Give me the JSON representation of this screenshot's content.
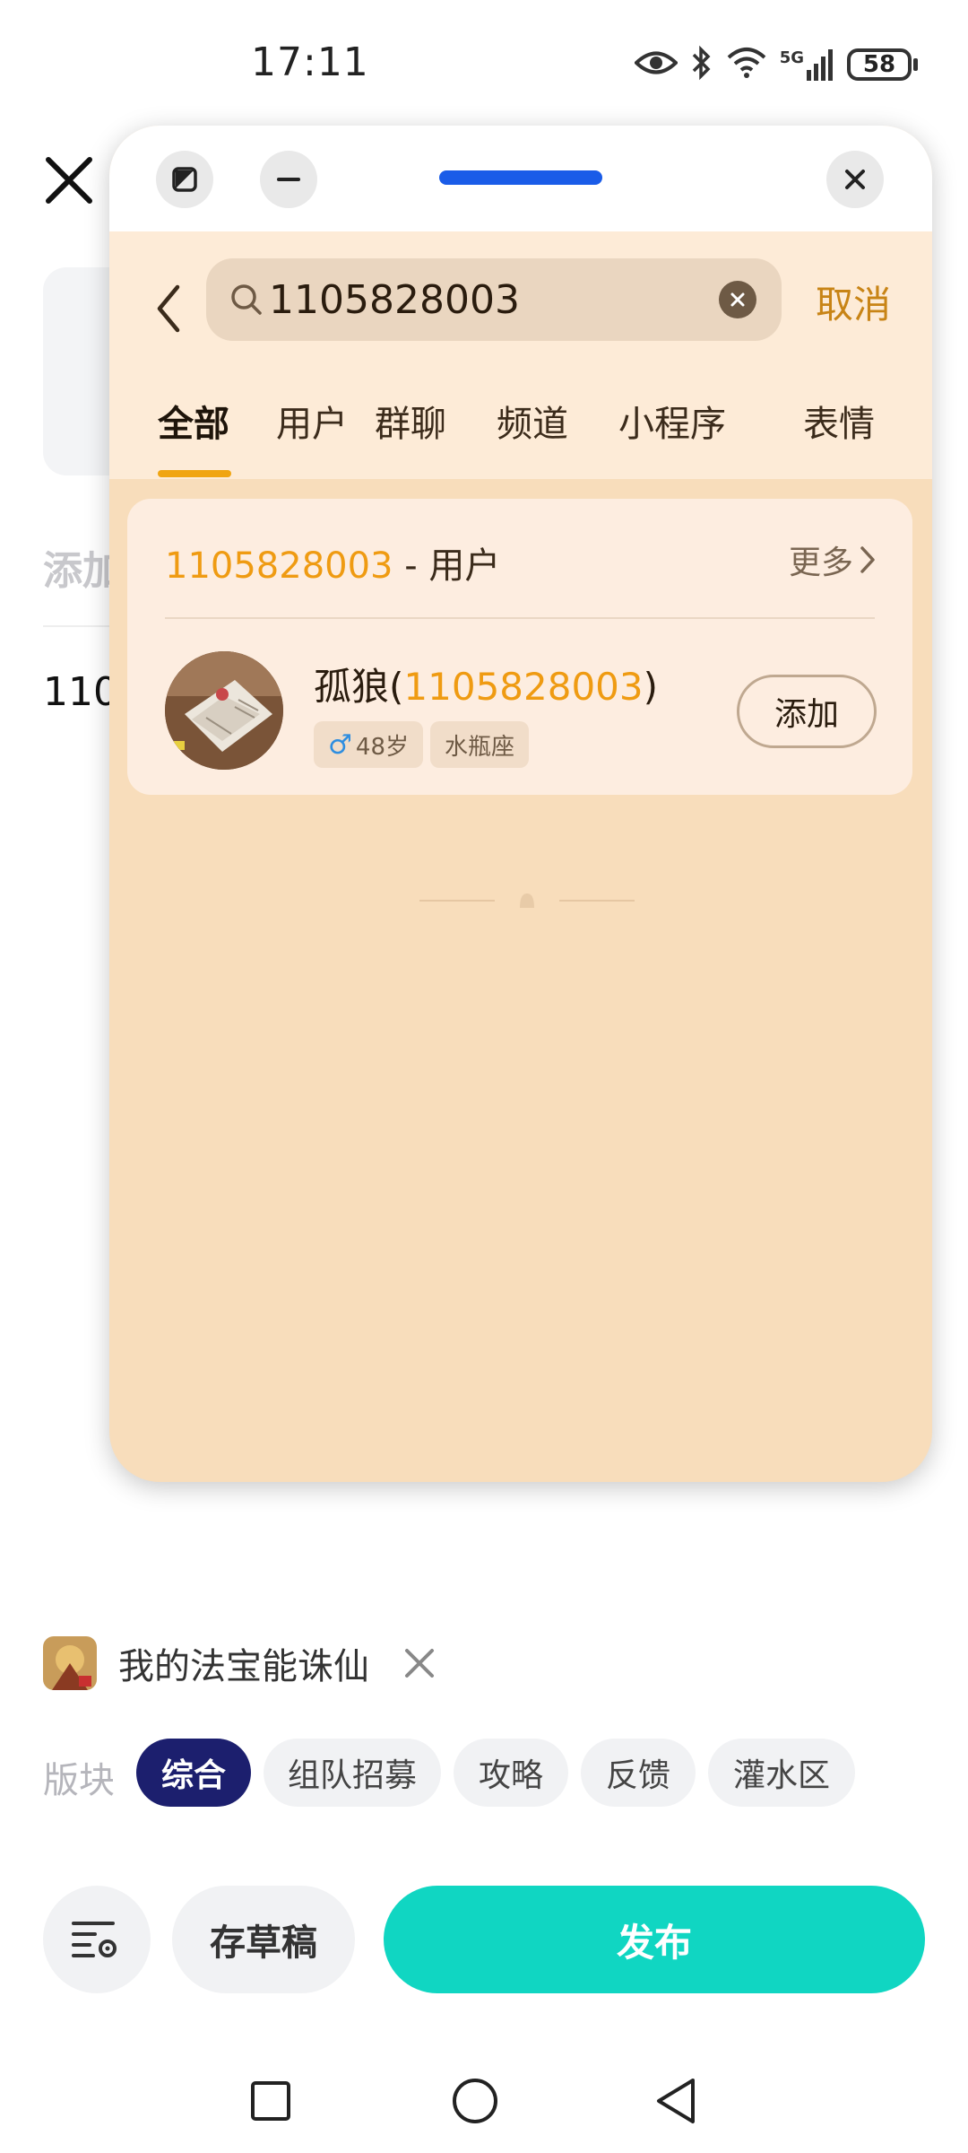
{
  "status_bar": {
    "time": "17:11",
    "network": "5G",
    "battery": "58",
    "icons": [
      "eye-icon",
      "bluetooth-icon",
      "wifi-icon",
      "signal-icon",
      "battery-icon"
    ]
  },
  "background_page": {
    "add_label": "添加",
    "number_text": "110"
  },
  "search_window": {
    "header_buttons": [
      "half-screen-icon",
      "minimize-icon",
      "close-icon"
    ],
    "search": {
      "value": "1105828003",
      "cancel_label": "取消"
    },
    "tabs": [
      {
        "label": "全部",
        "active": true
      },
      {
        "label": "用户",
        "active": false
      },
      {
        "label": "群聊",
        "active": false
      },
      {
        "label": "频道",
        "active": false
      },
      {
        "label": "小程序",
        "active": false
      },
      {
        "label": "表情",
        "active": false
      }
    ],
    "result": {
      "header_query": "1105828003",
      "header_suffix": " - 用户",
      "more_label": "更多",
      "user": {
        "name": "孤狼",
        "id": "1105828003",
        "gender": "♂",
        "age": "48岁",
        "zodiac": "水瓶座"
      },
      "add_label": "添加"
    }
  },
  "compose": {
    "game_name": "我的法宝能诛仙",
    "section_label": "版块",
    "sections": [
      {
        "label": "综合",
        "active": true
      },
      {
        "label": "组队招募",
        "active": false
      },
      {
        "label": "攻略",
        "active": false
      },
      {
        "label": "反馈",
        "active": false
      },
      {
        "label": "灌水区",
        "active": false
      }
    ],
    "draft_label": "存草稿",
    "publish_label": "发布"
  },
  "colors": {
    "accent_orange": "#ef9b12",
    "window_bg": "#f8ddbb",
    "publish": "#10d6c2",
    "active_chip": "#1c1f6e"
  }
}
